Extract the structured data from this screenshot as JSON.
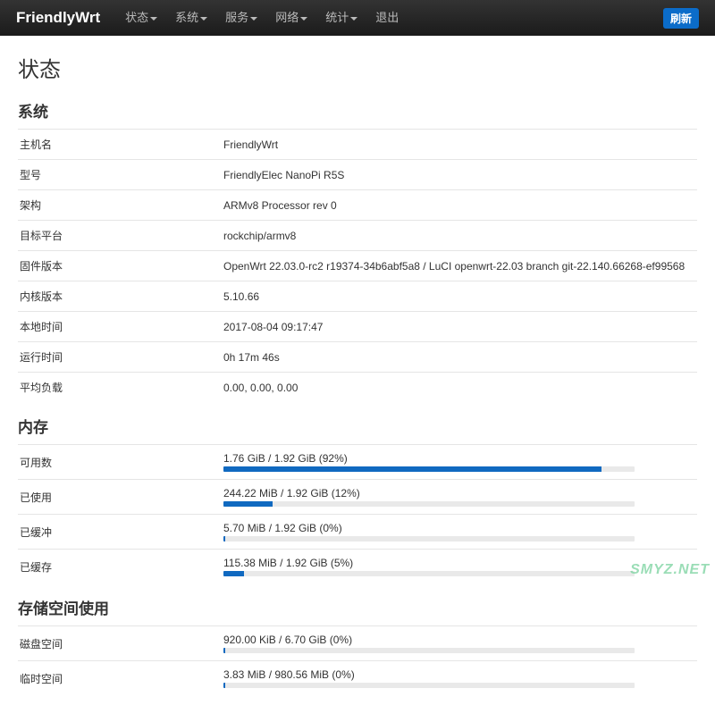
{
  "navbar": {
    "brand": "FriendlyWrt",
    "items": [
      {
        "label": "状态",
        "dropdown": true
      },
      {
        "label": "系统",
        "dropdown": true
      },
      {
        "label": "服务",
        "dropdown": true
      },
      {
        "label": "网络",
        "dropdown": true
      },
      {
        "label": "统计",
        "dropdown": true
      },
      {
        "label": "退出",
        "dropdown": false
      }
    ],
    "refresh": "刷新"
  },
  "page_title": "状态",
  "sections": {
    "system": {
      "heading": "系统",
      "rows": [
        {
          "label": "主机名",
          "value": "FriendlyWrt"
        },
        {
          "label": "型号",
          "value": "FriendlyElec NanoPi R5S"
        },
        {
          "label": "架构",
          "value": "ARMv8 Processor rev 0"
        },
        {
          "label": "目标平台",
          "value": "rockchip/armv8"
        },
        {
          "label": "固件版本",
          "value": "OpenWrt 22.03.0-rc2 r19374-34b6abf5a8 / LuCI openwrt-22.03 branch git-22.140.66268-ef99568"
        },
        {
          "label": "内核版本",
          "value": "5.10.66"
        },
        {
          "label": "本地时间",
          "value": "2017-08-04 09:17:47"
        },
        {
          "label": "运行时间",
          "value": "0h 17m 46s"
        },
        {
          "label": "平均负载",
          "value": "0.00, 0.00, 0.00"
        }
      ]
    },
    "memory": {
      "heading": "内存",
      "rows": [
        {
          "label": "可用数",
          "text": "1.76 GiB / 1.92 GiB (92%)",
          "pct": 92
        },
        {
          "label": "已使用",
          "text": "244.22 MiB / 1.92 GiB (12%)",
          "pct": 12
        },
        {
          "label": "已缓冲",
          "text": "5.70 MiB / 1.92 GiB (0%)",
          "pct": 0
        },
        {
          "label": "已缓存",
          "text": "115.38 MiB / 1.92 GiB (5%)",
          "pct": 5
        }
      ]
    },
    "storage": {
      "heading": "存储空间使用",
      "rows": [
        {
          "label": "磁盘空间",
          "text": "920.00 KiB / 6.70 GiB (0%)",
          "pct": 0
        },
        {
          "label": "临时空间",
          "text": "3.83 MiB / 980.56 MiB (0%)",
          "pct": 0
        }
      ]
    }
  },
  "watermark": "SMYZ.NET"
}
